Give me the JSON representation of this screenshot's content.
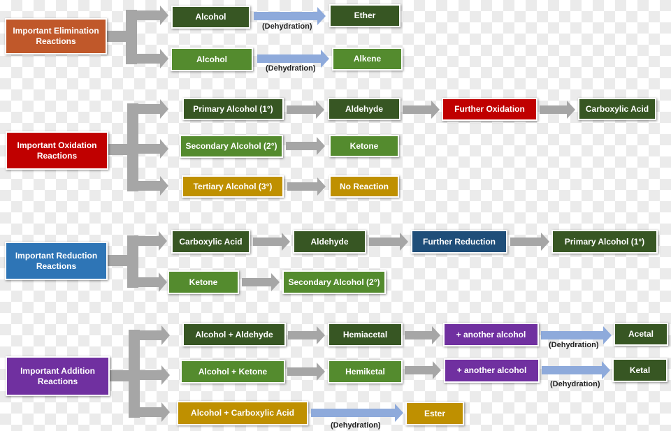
{
  "colors": {
    "elimination": "#c0582a",
    "oxidation": "#c00000",
    "reduction": "#2e75b6",
    "addition": "#7030a0",
    "dark_green": "#375623",
    "light_green": "#548b2e",
    "gold": "#bf9000",
    "navy": "#1f4e79",
    "purple": "#7030a0",
    "arrow_gray": "#a6a6a6",
    "arrow_blue": "#8eaadb"
  },
  "elimination": {
    "title": "Important Elimination Reactions",
    "row1": [
      "Alcohol",
      "Ether"
    ],
    "row2": [
      "Alcohol",
      "Alkene"
    ],
    "label1": "(Dehydration)",
    "label2": "(Dehydration)"
  },
  "oxidation": {
    "title": "Important Oxidation Reactions",
    "row1": [
      "Primary Alcohol (1°)",
      "Aldehyde",
      "Further Oxidation",
      "Carboxylic Acid"
    ],
    "row2": [
      "Secondary Alcohol (2°)",
      "Ketone"
    ],
    "row3": [
      "Tertiary Alcohol (3°)",
      "No Reaction"
    ]
  },
  "reduction": {
    "title": "Important Reduction Reactions",
    "row1": [
      "Carboxylic Acid",
      "Aldehyde",
      "Further Reduction",
      "Primary Alcohol (1°)"
    ],
    "row2": [
      "Ketone",
      "Secondary Alcohol (2°)"
    ]
  },
  "addition": {
    "title": "Important Addition Reactions",
    "row1": [
      "Alcohol + Aldehyde",
      "Hemiacetal",
      "+ another alcohol",
      "Acetal"
    ],
    "row2": [
      "Alcohol + Ketone",
      "Hemiketal",
      "+ another alcohol",
      "Ketal"
    ],
    "row3": [
      "Alcohol + Carboxylic Acid",
      "Ester"
    ],
    "label1": "(Dehydration)",
    "label2": "(Dehydration)",
    "label3": "(Dehydration)"
  }
}
